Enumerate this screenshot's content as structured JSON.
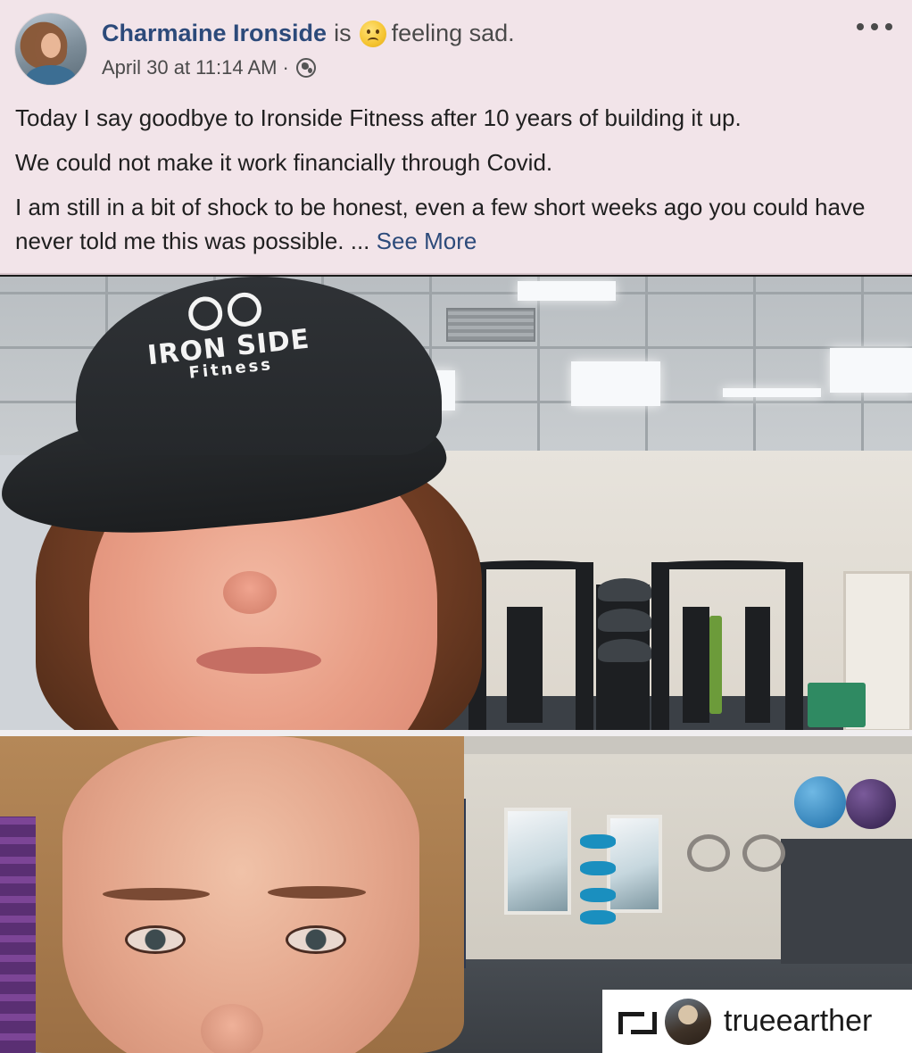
{
  "post": {
    "author": "Charmaine Ironside",
    "is_word": "is",
    "feeling_icon": "sad-face-emoji",
    "feeling": "feeling sad.",
    "timestamp": "April 30 at 11:14 AM",
    "separator": "·",
    "privacy_icon": "globe-icon",
    "paragraphs": [
      "Today I say goodbye to Ironside Fitness after 10 years of building it up.",
      "We could not make it work financially through Covid.",
      "I am still in a bit of shock to be honest, even a few short weeks ago you could have never told me this was possible. ..."
    ],
    "see_more": "See More"
  },
  "photo": {
    "cap_brand": "IRON SIDE",
    "cap_sub": "Fitness"
  },
  "repost": {
    "icon": "repost-icon",
    "username": "trueearther"
  },
  "colors": {
    "card_bg": "#f2e4e9",
    "link": "#2c4a7a"
  }
}
